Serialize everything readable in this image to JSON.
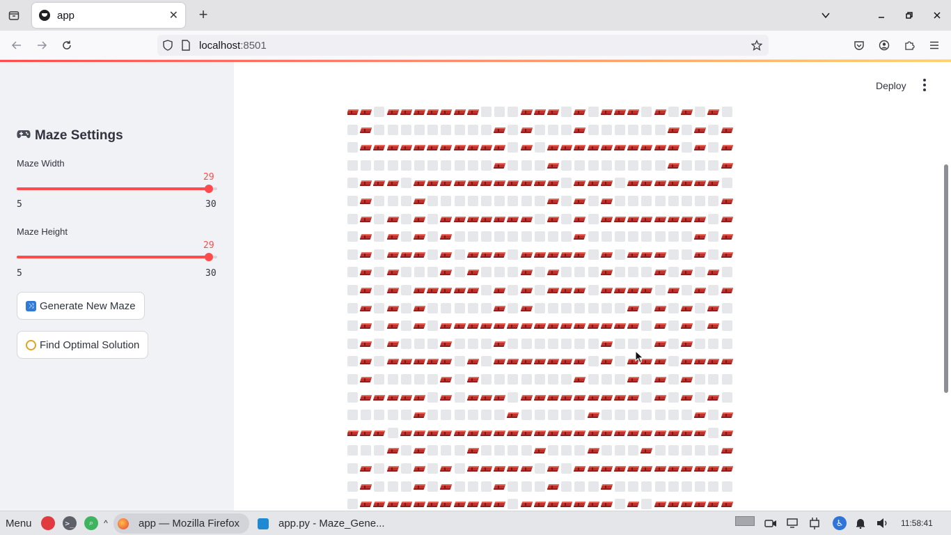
{
  "browser": {
    "tab_title": "app",
    "url_host": "localhost",
    "url_port": ":8501"
  },
  "sidebar": {
    "title": "Maze Settings",
    "width_slider": {
      "label": "Maze Width",
      "value": "29",
      "min": "5",
      "max": "30",
      "fraction": 0.96
    },
    "height_slider": {
      "label": "Maze Height",
      "value": "29",
      "min": "5",
      "max": "30",
      "fraction": 0.96
    },
    "generate_button": "Generate New Maze",
    "solve_button": "Find Optimal Solution"
  },
  "header": {
    "deploy_label": "Deploy"
  },
  "maze": {
    "legend": {
      "wall": "brick-icon",
      "path": "empty-cell"
    },
    "rows": [
      "WWPWWWWWWWPPPWWWPWPWWWPWPWPWP",
      "PWPPPPPPPPPWPWPPPWPPPPPPWPWPW",
      "PWWWWWWWWWWWPWPWWWWWWWWWWPWPW",
      "PPPPPPPPPPPWPPPWPPPPPPPPWPPPW",
      "PWWWPWWWWWWWWWWWPWWWPWWWWWWWP",
      "PWPPPWPPPPPPPPPWPWPWPPPPPPPPW",
      "PWPWPWPWWWWWWWPWPWPWWWWWWWWPW",
      "PWPWPWPWPPPPPPPPPWPPPPPPPPWPW",
      "PWPWWWPWPWWWPWWWWWPWPWWWPPWPW",
      "PWPWPPPWPWPPPWPWPPPWPPPWPWPWP",
      "PWPWPWWWWWPWPWPWWWPWWWWPWPWPW",
      "PWPWPWPPPPPWPWPPPPPPPWPWPWPWP",
      "PWPWPWPWWWWWWWWWWWWWWWPWPWPWP",
      "PWPWPPPWPPPWPPPPPPPWPPPWPWPPP",
      "PWPWWWWWPWPWWWWWWWPWPWWWPWWWW",
      "PWPPPPPWPWPPPPPPPWPPPWPWPWPPP",
      "PWWWWWPWPWWWPWWWWWWWWWPWPWPWP",
      "PPPPPWPPPPPPWPPPPPWPPPPPPPWPW",
      "WWWPWWWWWWWWWWWWWWWWWWWWWWWPW",
      "PPPWPWPPPWPPPPWPPPWPPPWPPPPPW",
      "PWPWPWPWPWWWWWPWPWWWWWWWWWWWW",
      "PWPPPWPWPPPWPPPWPPPWPPPPPPPPP",
      "PWWWWWWWWWWWPWWWWWWWPWPWWWWWW"
    ]
  },
  "taskbar": {
    "menu": "Menu",
    "firefox_task": "app — Mozilla Firefox",
    "vscode_task": "app.py - Maze_Gene...",
    "clock": "11:58:41"
  }
}
